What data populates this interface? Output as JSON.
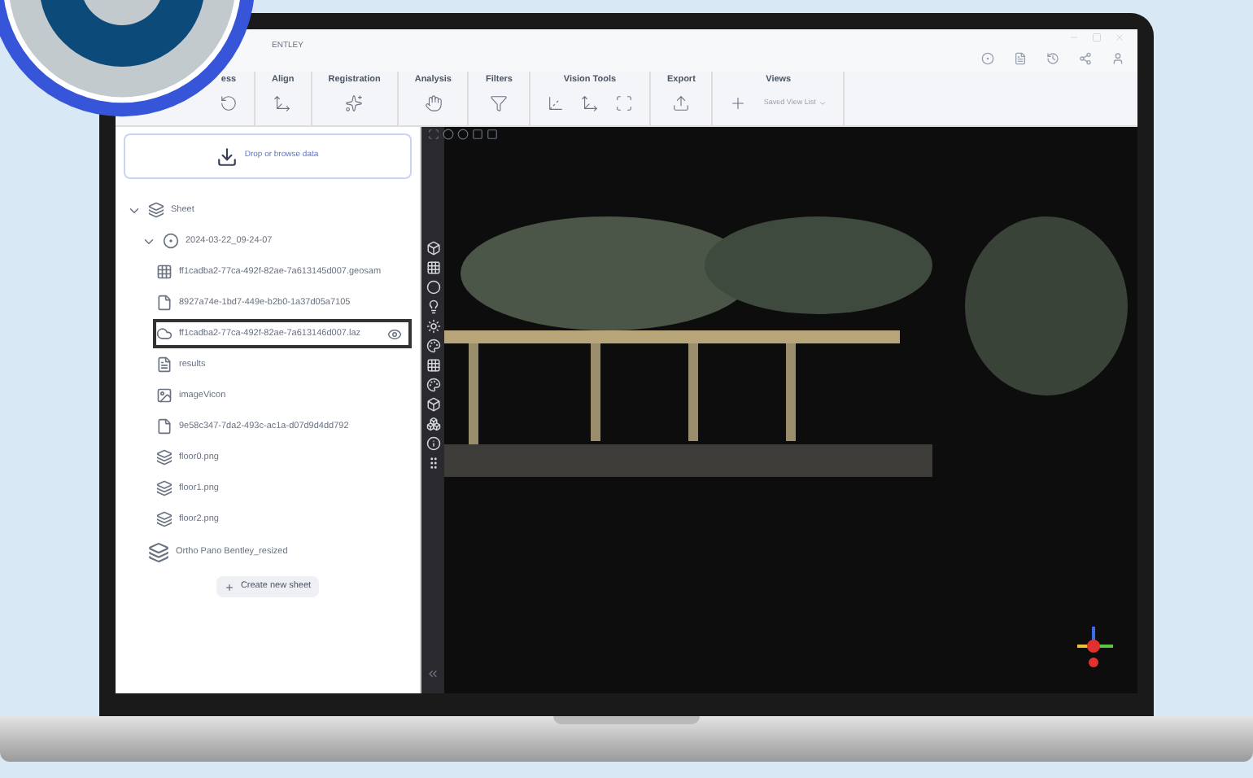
{
  "title_bar": {
    "app_name": "ENTLEY"
  },
  "ribbon": {
    "groups": [
      {
        "label": "ess"
      },
      {
        "label": "Align"
      },
      {
        "label": "Registration"
      },
      {
        "label": "Analysis"
      },
      {
        "label": "Filters"
      },
      {
        "label": "Vision Tools"
      },
      {
        "label": "Export"
      },
      {
        "label": "Views"
      }
    ],
    "saved_views": "Saved View List"
  },
  "data_panel": {
    "drop_label": "Drop or browse data",
    "tree": [
      {
        "kind": "sheet",
        "label": "Sheet",
        "expanded": true,
        "selected": false,
        "children": [
          {
            "kind": "capture",
            "label": "2024-03-22_09-24-07",
            "expanded": true,
            "selected": false,
            "children": [
              {
                "kind": "mesh",
                "label": "ff1cadba2-77ca-492f-82ae-7a613145d007.geosam",
                "selected": false
              },
              {
                "kind": "file",
                "label": "8927a74e-1bd7-449e-b2b0-1a37d05a7105",
                "selected": false
              },
              {
                "kind": "cloud",
                "label": "ff1cadba2-77ca-492f-82ae-7a613146d007.laz",
                "selected": true
              },
              {
                "kind": "results",
                "label": "results",
                "selected": false
              },
              {
                "kind": "image",
                "label": "imageVicon",
                "selected": false
              },
              {
                "kind": "file",
                "label": "9e58c347-7da2-493c-ac1a-d07d9d4dd792",
                "selected": false
              },
              {
                "kind": "sheet",
                "label": "floor0.png",
                "selected": false
              },
              {
                "kind": "sheet",
                "label": "floor1.png",
                "selected": false
              },
              {
                "kind": "sheet",
                "label": "floor2.png",
                "selected": false
              }
            ]
          }
        ]
      },
      {
        "kind": "sheet",
        "label": "Ortho Pano Bentley_resized",
        "expanded": false,
        "selected": false
      }
    ],
    "create_button": "Create new sheet"
  }
}
